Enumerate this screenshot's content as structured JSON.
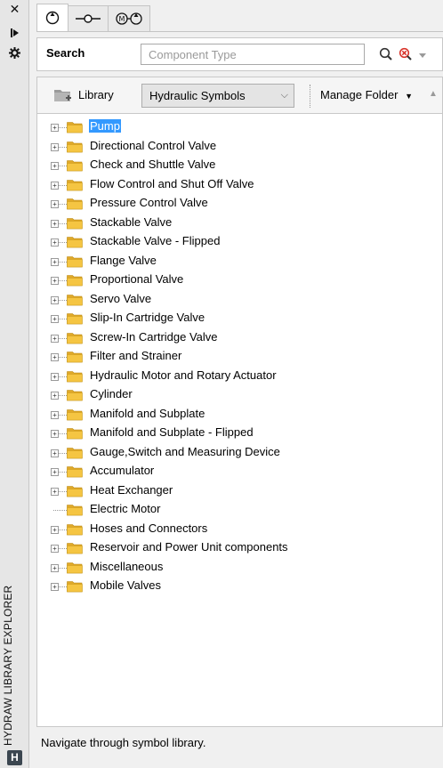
{
  "window": {
    "title": "HYDRAW LIBRARY EXPLORER",
    "close_icon": "close-icon",
    "pin_icon": "pin-icon",
    "settings_icon": "gear-icon",
    "logo_icon": "hydraw-logo-icon"
  },
  "tabs": [
    {
      "icon": "pump-symbol-icon",
      "active": true
    },
    {
      "icon": "valve-port-symbol-icon",
      "active": false
    },
    {
      "icon": "motor-symbol-icon",
      "active": false
    }
  ],
  "search": {
    "label": "Search",
    "placeholder": "Component Type",
    "value": ""
  },
  "library": {
    "label": "Library",
    "selected": "Hydraulic Symbols",
    "manage_label": "Manage Folder"
  },
  "tree": [
    {
      "label": "Pump",
      "expandable": true,
      "selected": true
    },
    {
      "label": "Directional Control Valve",
      "expandable": true
    },
    {
      "label": "Check and Shuttle Valve",
      "expandable": true
    },
    {
      "label": "Flow Control and Shut Off Valve",
      "expandable": true
    },
    {
      "label": "Pressure Control Valve",
      "expandable": true
    },
    {
      "label": "Stackable Valve",
      "expandable": true
    },
    {
      "label": "Stackable Valve - Flipped",
      "expandable": true
    },
    {
      "label": "Flange Valve",
      "expandable": true
    },
    {
      "label": "Proportional Valve",
      "expandable": true
    },
    {
      "label": "Servo Valve",
      "expandable": true
    },
    {
      "label": "Slip-In Cartridge Valve",
      "expandable": true
    },
    {
      "label": "Screw-In Cartridge Valve",
      "expandable": true
    },
    {
      "label": "Filter and Strainer",
      "expandable": true
    },
    {
      "label": "Hydraulic Motor and Rotary Actuator",
      "expandable": true
    },
    {
      "label": "Cylinder",
      "expandable": true
    },
    {
      "label": "Manifold and Subplate",
      "expandable": true
    },
    {
      "label": "Manifold and Subplate - Flipped",
      "expandable": true
    },
    {
      "label": "Gauge,Switch and Measuring Device",
      "expandable": true
    },
    {
      "label": "Accumulator",
      "expandable": true
    },
    {
      "label": "Heat Exchanger",
      "expandable": true
    },
    {
      "label": "Electric Motor",
      "expandable": false
    },
    {
      "label": "Hoses and Connectors",
      "expandable": true
    },
    {
      "label": "Reservoir and Power Unit components",
      "expandable": true
    },
    {
      "label": "Miscellaneous",
      "expandable": true
    },
    {
      "label": "Mobile Valves",
      "expandable": true
    }
  ],
  "status": {
    "text": "Navigate through symbol library."
  },
  "colors": {
    "selection": "#3399ff",
    "folder": "#f5c542",
    "clear_icon": "#d9342b"
  }
}
